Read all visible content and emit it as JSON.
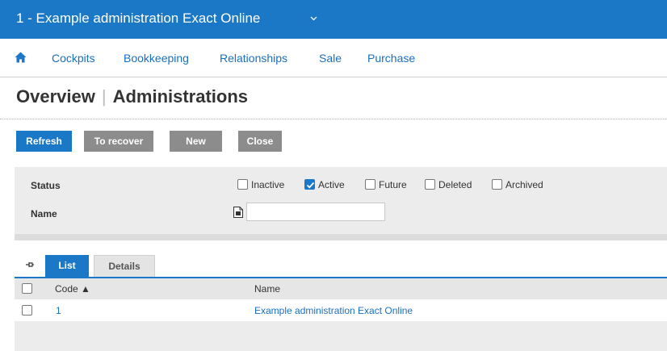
{
  "header": {
    "title": "1 - Example administration Exact Online",
    "dropdown_icon": "chevron-down-icon"
  },
  "nav": {
    "home_icon": "home-icon",
    "items": [
      {
        "label": "Cockpits"
      },
      {
        "label": "Bookkeeping"
      },
      {
        "label": "Relationships"
      },
      {
        "label": "Sale"
      },
      {
        "label": "Purchase"
      }
    ]
  },
  "page": {
    "title_left": "Overview",
    "title_right": "Administrations"
  },
  "toolbar": {
    "refresh_label": "Refresh",
    "recover_label": "To recover",
    "new_label": "New",
    "close_label": "Close"
  },
  "filters": {
    "status_label": "Status",
    "name_label": "Name",
    "name_value": "",
    "status_options": [
      {
        "label": "Inactive",
        "checked": false
      },
      {
        "label": "Active",
        "checked": true
      },
      {
        "label": "Future",
        "checked": false
      },
      {
        "label": "Deleted",
        "checked": false
      },
      {
        "label": "Archived",
        "checked": false
      }
    ]
  },
  "tabs": [
    {
      "label": "List",
      "active": true
    },
    {
      "label": "Details",
      "active": false
    }
  ],
  "table": {
    "columns": {
      "code": "Code ▲",
      "name": "Name"
    },
    "rows": [
      {
        "code": "1",
        "name": "Example administration Exact Online"
      }
    ]
  },
  "colors": {
    "primary": "#1b78c6",
    "button_gray": "#8c8c8c",
    "link": "#1b6fc0",
    "panel": "#ececec"
  }
}
